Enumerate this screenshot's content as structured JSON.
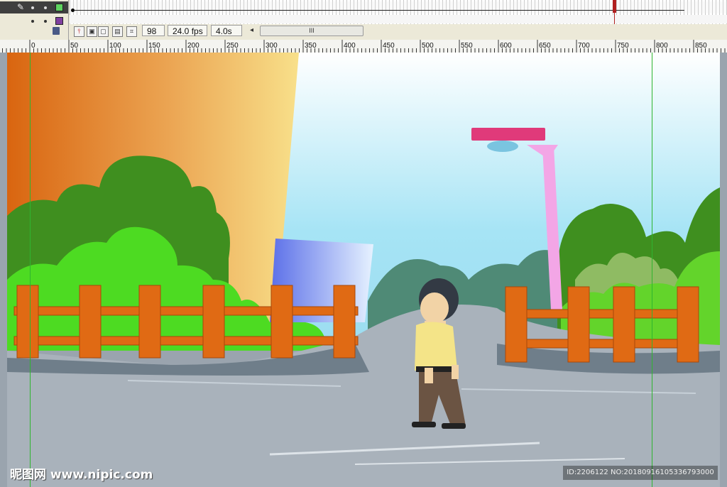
{
  "timeline": {
    "frame_number": "98",
    "frame_rate": "24.0 fps",
    "elapsed_time": "4.0s",
    "scroll_grip": "III",
    "scroll_left_arrow": "◂",
    "layer1_swatch_color": "#5fd35f",
    "layer2_swatch_color": "#8040a0"
  },
  "ruler": {
    "labels": [
      "0",
      "50",
      "100",
      "150",
      "200",
      "250",
      "300",
      "350",
      "400",
      "450",
      "500",
      "550",
      "600",
      "650",
      "700",
      "750",
      "800",
      "850"
    ]
  },
  "stage": {
    "colors": {
      "orange_wall": "#e07a1e",
      "sky": "#bfe8f7",
      "road": "#a8b0b8",
      "fence": "#e06a14",
      "bush_dark": "#3f8f1f",
      "bush_light": "#5cd12a",
      "lamp": "#f07fc8",
      "guide": "#2fb52f"
    }
  },
  "watermark": {
    "text": "昵图网 www.nipic.com",
    "id_text": "ID:2206122 NO:20180916105336793000"
  }
}
